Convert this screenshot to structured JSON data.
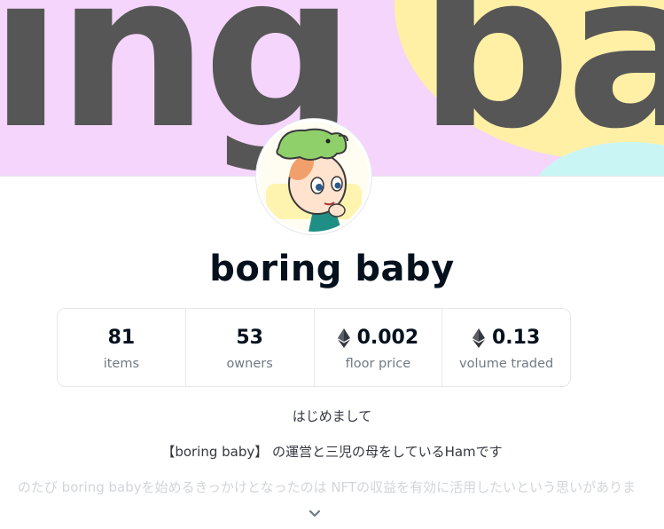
{
  "banner": {
    "text": "ing ba"
  },
  "collection": {
    "name": "boring baby"
  },
  "stats": [
    {
      "value": "81",
      "label": "items",
      "eth": false
    },
    {
      "value": "53",
      "label": "owners",
      "eth": false
    },
    {
      "value": "0.002",
      "label": "floor price",
      "eth": true
    },
    {
      "value": "0.13",
      "label": "volume traded",
      "eth": true
    }
  ],
  "description": {
    "line1": "はじめまして",
    "line2": "【boring baby】 の運営と三児の母をしているHamです",
    "line3": "のたび boring babyを始めるきっかけとなったのは NFTの収益を有効に活用したいという思いがありま"
  },
  "colors": {
    "banner_bg": "#f5d5fb",
    "banner_accent": "#fff0a6",
    "title": "#04111d",
    "muted": "#707a83",
    "border": "#e5e8eb"
  },
  "icons": {
    "currency": "ethereum-icon",
    "expand": "chevron-down-icon"
  }
}
